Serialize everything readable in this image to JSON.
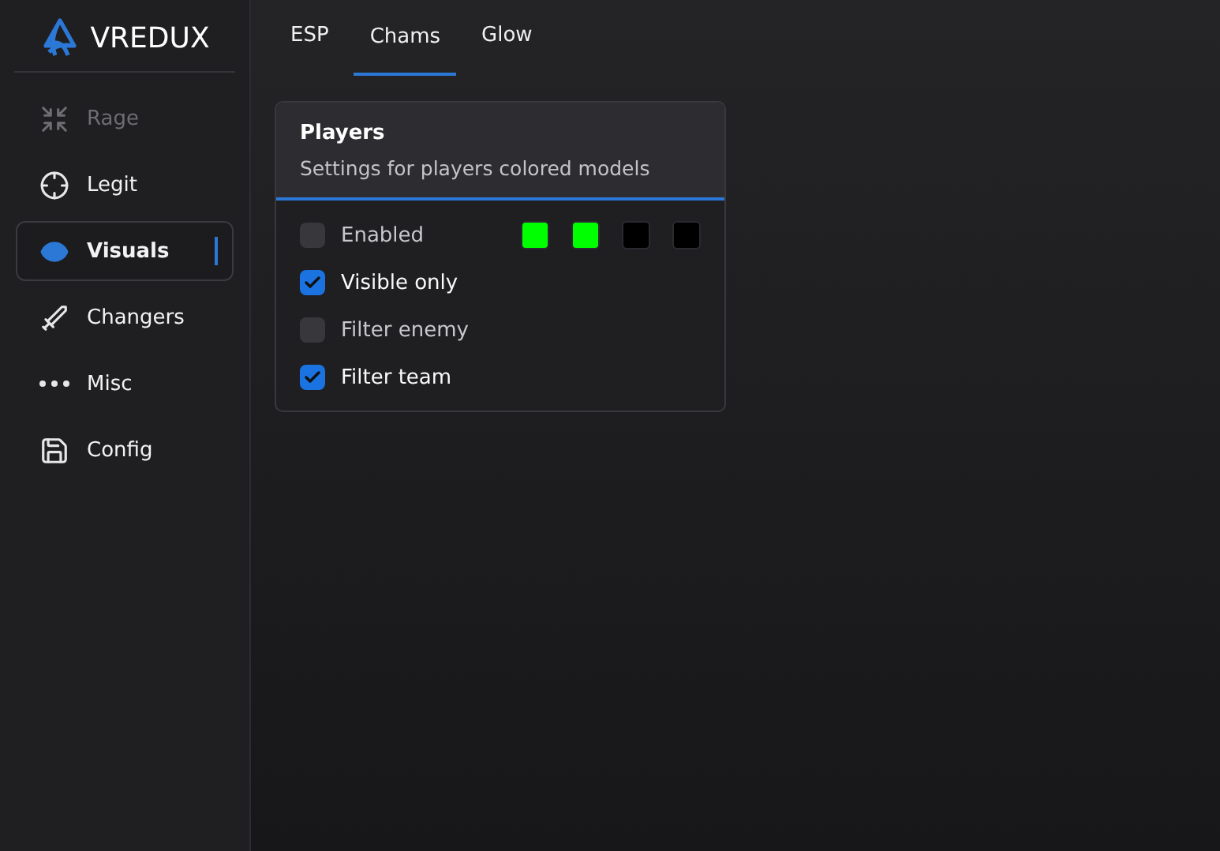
{
  "brand": {
    "name": "VREDUX"
  },
  "sidebar": {
    "items": [
      {
        "label": "Rage",
        "selected": false,
        "disabled": true
      },
      {
        "label": "Legit",
        "selected": false,
        "disabled": false
      },
      {
        "label": "Visuals",
        "selected": true,
        "disabled": false
      },
      {
        "label": "Changers",
        "selected": false,
        "disabled": false
      },
      {
        "label": "Misc",
        "selected": false,
        "disabled": false
      },
      {
        "label": "Config",
        "selected": false,
        "disabled": false
      }
    ]
  },
  "tabs": [
    {
      "label": "ESP",
      "selected": false
    },
    {
      "label": "Chams",
      "selected": true
    },
    {
      "label": "Glow",
      "selected": false
    }
  ],
  "card": {
    "title": "Players",
    "subtitle": "Settings for players colored models",
    "options": [
      {
        "label": "Enabled",
        "checked": false,
        "swatches": [
          {
            "color": "#00ff00"
          },
          {
            "color": "#00ff00"
          },
          {
            "color": "#000000"
          },
          {
            "color": "#000000"
          }
        ]
      },
      {
        "label": "Visible only",
        "checked": true
      },
      {
        "label": "Filter enemy",
        "checked": false
      },
      {
        "label": "Filter team",
        "checked": true
      }
    ]
  }
}
